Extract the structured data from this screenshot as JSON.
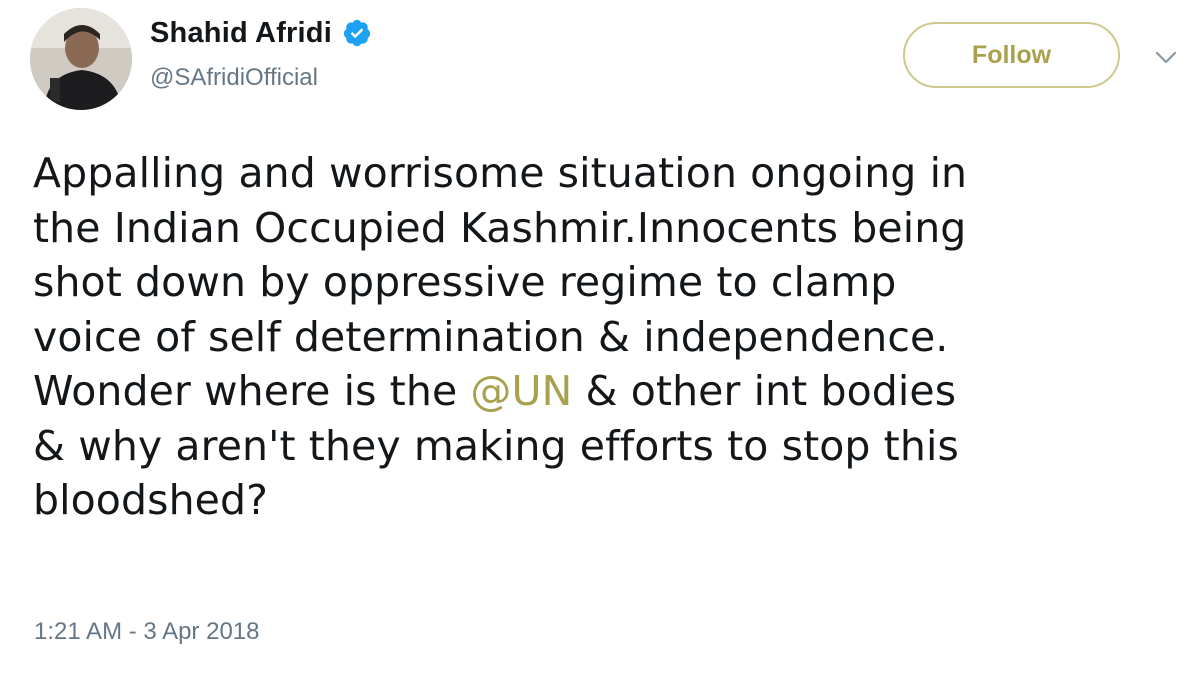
{
  "author": {
    "display_name": "Shahid Afridi",
    "handle": "@SAfridiOfficial",
    "verified": true,
    "avatar_icon": "profile-photo"
  },
  "actions": {
    "follow_label": "Follow",
    "menu_icon": "chevron-down-icon"
  },
  "tweet": {
    "lines": [
      {
        "text": "Appalling and worrisome situation ongoing in"
      },
      {
        "text": "the Indian Occupied Kashmir.Innocents being"
      },
      {
        "text": "shot down by oppressive regime to clamp"
      },
      {
        "text": "voice of self determination & independence."
      },
      {
        "before": "Wonder where is the ",
        "mention": "@UN",
        "after": " & other int bodies"
      },
      {
        "text": "& why aren't they making efforts to stop this"
      },
      {
        "text": "bloodshed?"
      }
    ],
    "timestamp": "1:21 AM - 3 Apr 2018"
  },
  "colors": {
    "accent": "#a8a14f",
    "follow_border": "#cfc98f",
    "text": "#14171a",
    "secondary": "#657786",
    "verified_badge": "#1da1f2"
  }
}
